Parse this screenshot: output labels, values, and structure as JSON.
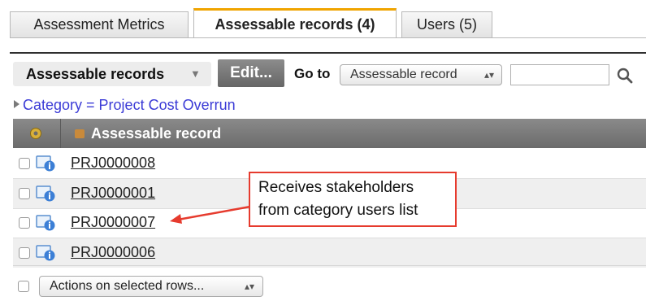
{
  "tabs": [
    {
      "label": "Assessment Metrics"
    },
    {
      "label": "Assessable records (4)"
    },
    {
      "label": "Users (5)"
    }
  ],
  "toolbar": {
    "list_label": "Assessable records",
    "edit_label": "Edit...",
    "goto_label": "Go to",
    "goto_value": "Assessable record",
    "search_value": ""
  },
  "filter": {
    "label": "Category = Project Cost Overrun"
  },
  "table": {
    "header": "Assessable record",
    "rows": [
      {
        "number": "PRJ0000008"
      },
      {
        "number": "PRJ0000001"
      },
      {
        "number": "PRJ0000007"
      },
      {
        "number": "PRJ0000006"
      }
    ]
  },
  "callout": {
    "line1": "Receives stakeholders",
    "line2": "from category users list"
  },
  "footer": {
    "actions_label": "Actions on selected rows..."
  },
  "colors": {
    "active_tab_accent": "#f0a400",
    "filter_link": "#3b3bd6",
    "callout_border": "#e63b2e"
  }
}
